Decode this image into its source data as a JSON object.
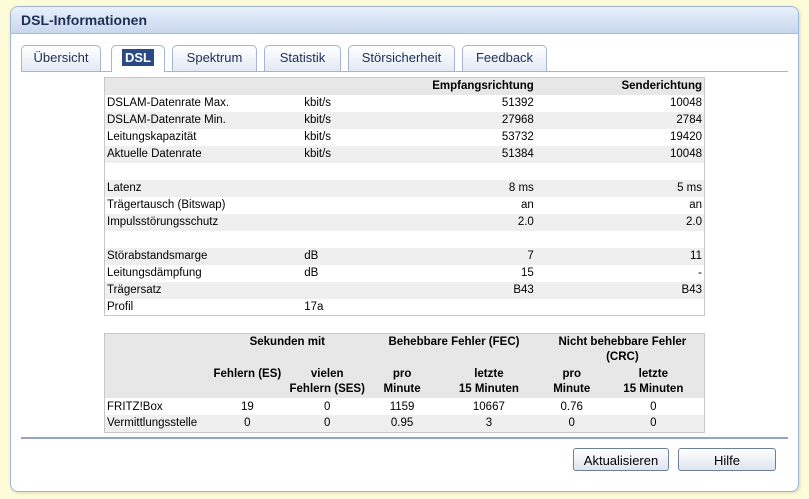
{
  "header": {
    "title": "DSL-Informationen"
  },
  "tabs": [
    {
      "label": "Übersicht"
    },
    {
      "label": "DSL"
    },
    {
      "label": "Spektrum"
    },
    {
      "label": "Statistik"
    },
    {
      "label": "Störsicherheit"
    },
    {
      "label": "Feedback"
    }
  ],
  "main_table": {
    "col_down": "Empfangsrichtung",
    "col_up": "Senderichtung",
    "rows": [
      {
        "label": "DSLAM-Datenrate Max.",
        "unit": "kbit/s",
        "down": "51392",
        "up": "10048"
      },
      {
        "label": "DSLAM-Datenrate Min.",
        "unit": "kbit/s",
        "down": "27968",
        "up": "2784"
      },
      {
        "label": "Leitungskapazität",
        "unit": "kbit/s",
        "down": "53732",
        "up": "19420"
      },
      {
        "label": "Aktuelle Datenrate",
        "unit": "kbit/s",
        "down": "51384",
        "up": "10048"
      },
      {
        "label": "Latenz",
        "unit": "",
        "down": "8 ms",
        "up": "5 ms"
      },
      {
        "label": "Trägertausch (Bitswap)",
        "unit": "",
        "down": "an",
        "up": "an"
      },
      {
        "label": "Impulsstörungsschutz",
        "unit": "",
        "down": "2.0",
        "up": "2.0"
      },
      {
        "label": "Störabstandsmarge",
        "unit": "dB",
        "down": "7",
        "up": "11"
      },
      {
        "label": "Leitungsdämpfung",
        "unit": "dB",
        "down": "15",
        "up": "-"
      },
      {
        "label": "Trägersatz",
        "unit": "",
        "down": "B43",
        "up": "B43"
      },
      {
        "label": "Profil",
        "unit": "17a",
        "down": "",
        "up": ""
      }
    ]
  },
  "error_table": {
    "group_seconds": "Sekunden mit",
    "group_fec": "Behebbare Fehler (FEC)",
    "group_crc": "Nicht behebbare Fehler (CRC)",
    "sub_es": "Fehlern (ES)",
    "sub_ses_1": "vielen",
    "sub_ses_2": "Fehlern (SES)",
    "sub_per_1": "pro",
    "sub_per_2": "Minute",
    "sub_last_1": "letzte",
    "sub_last_2": "15 Minuten",
    "rows": [
      {
        "label": "FRITZ!Box",
        "es": "19",
        "ses": "0",
        "fec_min": "1159",
        "fec_15": "10667",
        "crc_min": "0.76",
        "crc_15": "0"
      },
      {
        "label": "Vermittlungsstelle",
        "es": "0",
        "ses": "0",
        "fec_min": "0.95",
        "fec_15": "3",
        "crc_min": "0",
        "crc_15": "0"
      }
    ]
  },
  "buttons": {
    "refresh": "Aktualisieren",
    "help": "Hilfe"
  }
}
